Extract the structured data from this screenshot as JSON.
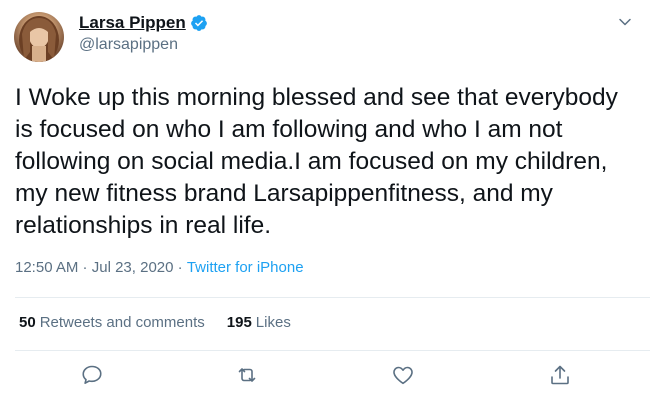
{
  "author": {
    "display_name": "Larsa Pippen",
    "handle": "@larsapippen",
    "verified": true
  },
  "tweet": {
    "text": "I Woke up this morning blessed and see that everybody is focused on who I am following and who I am not following on social media.I am focused on my children, my new fitness brand Larsapippenfitness, and my relationships in real life.",
    "time": "12:50 AM",
    "separator": " · ",
    "date": "Jul 23, 2020",
    "source": "Twitter for iPhone"
  },
  "stats": {
    "retweets_count": "50",
    "retweets_label": "Retweets and comments",
    "likes_count": "195",
    "likes_label": "Likes"
  },
  "icons": {
    "more": "chevron-down-icon",
    "reply": "reply-icon",
    "retweet": "retweet-icon",
    "like": "heart-icon",
    "share": "share-icon",
    "verified": "verified-badge-icon"
  },
  "colors": {
    "accent": "#1da1f2",
    "secondary_text": "#5b7083",
    "primary_text": "#0f1419",
    "divider": "#e6ecf0"
  }
}
